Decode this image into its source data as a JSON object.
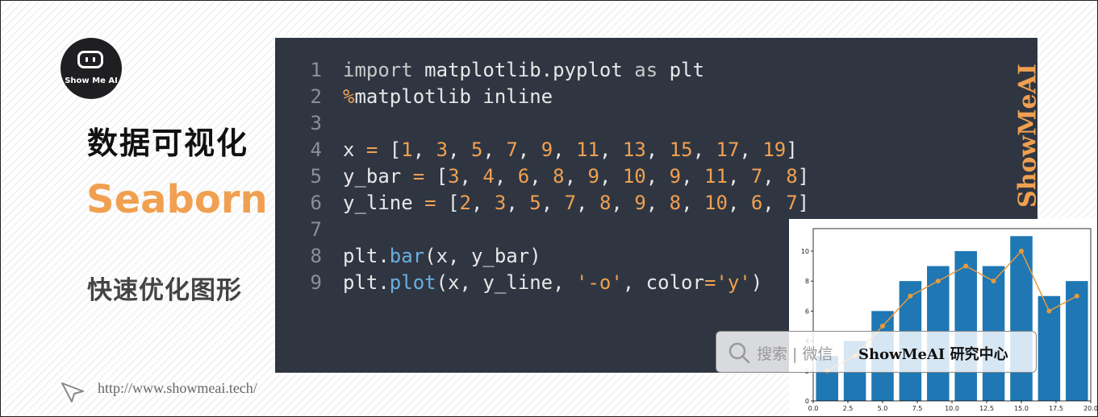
{
  "brand": {
    "logo_text": "Show Me AI",
    "watermark": "ShowMeAI"
  },
  "slide": {
    "title_cn": "数据可视化",
    "title_en": "Seaborn",
    "subtitle": "快速优化图形",
    "url": "http://www.showmeai.tech/"
  },
  "code_lines": [
    {
      "num": "1",
      "tokens": [
        {
          "t": "import ",
          "c": "k"
        },
        {
          "t": "matplotlib.pyplot ",
          "c": ""
        },
        {
          "t": "as ",
          "c": "k"
        },
        {
          "t": "plt",
          "c": ""
        }
      ]
    },
    {
      "num": "2",
      "tokens": [
        {
          "t": "%",
          "c": "o"
        },
        {
          "t": "matplotlib inline",
          "c": ""
        }
      ]
    },
    {
      "num": "3",
      "tokens": []
    },
    {
      "num": "4",
      "tokens": [
        {
          "t": "x ",
          "c": ""
        },
        {
          "t": "=",
          "c": "o"
        },
        {
          "t": " [",
          "c": ""
        },
        {
          "t": "1",
          "c": "n"
        },
        {
          "t": ", ",
          "c": ""
        },
        {
          "t": "3",
          "c": "n"
        },
        {
          "t": ", ",
          "c": ""
        },
        {
          "t": "5",
          "c": "n"
        },
        {
          "t": ", ",
          "c": ""
        },
        {
          "t": "7",
          "c": "n"
        },
        {
          "t": ", ",
          "c": ""
        },
        {
          "t": "9",
          "c": "n"
        },
        {
          "t": ", ",
          "c": ""
        },
        {
          "t": "11",
          "c": "n"
        },
        {
          "t": ", ",
          "c": ""
        },
        {
          "t": "13",
          "c": "n"
        },
        {
          "t": ", ",
          "c": ""
        },
        {
          "t": "15",
          "c": "n"
        },
        {
          "t": ", ",
          "c": ""
        },
        {
          "t": "17",
          "c": "n"
        },
        {
          "t": ", ",
          "c": ""
        },
        {
          "t": "19",
          "c": "n"
        },
        {
          "t": "]",
          "c": ""
        }
      ]
    },
    {
      "num": "5",
      "tokens": [
        {
          "t": "y_bar ",
          "c": ""
        },
        {
          "t": "=",
          "c": "o"
        },
        {
          "t": " [",
          "c": ""
        },
        {
          "t": "3",
          "c": "n"
        },
        {
          "t": ", ",
          "c": ""
        },
        {
          "t": "4",
          "c": "n"
        },
        {
          "t": ", ",
          "c": ""
        },
        {
          "t": "6",
          "c": "n"
        },
        {
          "t": ", ",
          "c": ""
        },
        {
          "t": "8",
          "c": "n"
        },
        {
          "t": ", ",
          "c": ""
        },
        {
          "t": "9",
          "c": "n"
        },
        {
          "t": ", ",
          "c": ""
        },
        {
          "t": "10",
          "c": "n"
        },
        {
          "t": ", ",
          "c": ""
        },
        {
          "t": "9",
          "c": "n"
        },
        {
          "t": ", ",
          "c": ""
        },
        {
          "t": "11",
          "c": "n"
        },
        {
          "t": ", ",
          "c": ""
        },
        {
          "t": "7",
          "c": "n"
        },
        {
          "t": ", ",
          "c": ""
        },
        {
          "t": "8",
          "c": "n"
        },
        {
          "t": "]",
          "c": ""
        }
      ]
    },
    {
      "num": "6",
      "tokens": [
        {
          "t": "y_line ",
          "c": ""
        },
        {
          "t": "=",
          "c": "o"
        },
        {
          "t": " [",
          "c": ""
        },
        {
          "t": "2",
          "c": "n"
        },
        {
          "t": ", ",
          "c": ""
        },
        {
          "t": "3",
          "c": "n"
        },
        {
          "t": ", ",
          "c": ""
        },
        {
          "t": "5",
          "c": "n"
        },
        {
          "t": ", ",
          "c": ""
        },
        {
          "t": "7",
          "c": "n"
        },
        {
          "t": ", ",
          "c": ""
        },
        {
          "t": "8",
          "c": "n"
        },
        {
          "t": ", ",
          "c": ""
        },
        {
          "t": "9",
          "c": "n"
        },
        {
          "t": ", ",
          "c": ""
        },
        {
          "t": "8",
          "c": "n"
        },
        {
          "t": ", ",
          "c": ""
        },
        {
          "t": "10",
          "c": "n"
        },
        {
          "t": ", ",
          "c": ""
        },
        {
          "t": "6",
          "c": "n"
        },
        {
          "t": ", ",
          "c": ""
        },
        {
          "t": "7",
          "c": "n"
        },
        {
          "t": "]",
          "c": ""
        }
      ]
    },
    {
      "num": "7",
      "tokens": []
    },
    {
      "num": "8",
      "tokens": [
        {
          "t": "plt.",
          "c": ""
        },
        {
          "t": "bar",
          "c": "f"
        },
        {
          "t": "(x, y_bar)",
          "c": ""
        }
      ]
    },
    {
      "num": "9",
      "tokens": [
        {
          "t": "plt.",
          "c": ""
        },
        {
          "t": "plot",
          "c": "f"
        },
        {
          "t": "(x, y_line, ",
          "c": ""
        },
        {
          "t": "'-o'",
          "c": "s"
        },
        {
          "t": ", color",
          "c": ""
        },
        {
          "t": "=",
          "c": "o"
        },
        {
          "t": "'y'",
          "c": "s"
        },
        {
          "t": ")",
          "c": ""
        }
      ]
    }
  ],
  "search_bar": {
    "label": "搜索 | 微信",
    "brand": "ShowMeAI 研究中心"
  },
  "colors": {
    "accent": "#f0a050",
    "bar": "#1f77b4",
    "line": "#e69a3c",
    "code_bg": "#2f3642"
  },
  "icons": {
    "logo": "robot-screen-icon",
    "search": "search-icon",
    "cursor": "cursor-icon"
  },
  "chart_data": {
    "type": "bar",
    "x": [
      1,
      3,
      5,
      7,
      9,
      11,
      13,
      15,
      17,
      19
    ],
    "series": [
      {
        "kind": "bar",
        "values": [
          3,
          4,
          6,
          8,
          9,
          10,
          9,
          11,
          7,
          8
        ]
      },
      {
        "kind": "line",
        "values": [
          2,
          3,
          5,
          7,
          8,
          9,
          8,
          10,
          6,
          7
        ]
      }
    ],
    "xlim": [
      0,
      20
    ],
    "ylim": [
      0,
      11.5
    ],
    "xticks": [
      "0.0",
      "2.5",
      "5.0",
      "7.5",
      "10.0",
      "12.5",
      "15.0",
      "17.5",
      "20.0"
    ],
    "yticks": [
      "0",
      "2",
      "4",
      "6",
      "8",
      "10"
    ],
    "grid": false
  }
}
